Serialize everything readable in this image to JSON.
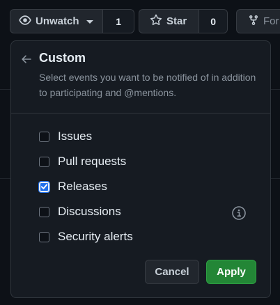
{
  "header": {
    "unwatch_label": "Unwatch",
    "watch_count": "1",
    "star_label": "Star",
    "star_count": "0",
    "fork_label": "For"
  },
  "panel": {
    "title": "Custom",
    "description": "Select events you want to be notified of in addition to participating and @mentions.",
    "options": [
      {
        "label": "Issues",
        "checked": false
      },
      {
        "label": "Pull requests",
        "checked": false
      },
      {
        "label": "Releases",
        "checked": true
      },
      {
        "label": "Discussions",
        "checked": false
      },
      {
        "label": "Security alerts",
        "checked": false
      }
    ],
    "cancel_label": "Cancel",
    "apply_label": "Apply"
  },
  "icons": {
    "eye": "eye-icon",
    "star": "star-icon",
    "fork": "fork-icon",
    "back": "arrow-left-icon",
    "info": "info-icon",
    "check": "check-icon"
  },
  "colors": {
    "background": "#0d1117",
    "panel": "#161b22",
    "apply": "#238636",
    "checkbox_checked": "#1f6feb",
    "muted_text": "#8b949e"
  }
}
